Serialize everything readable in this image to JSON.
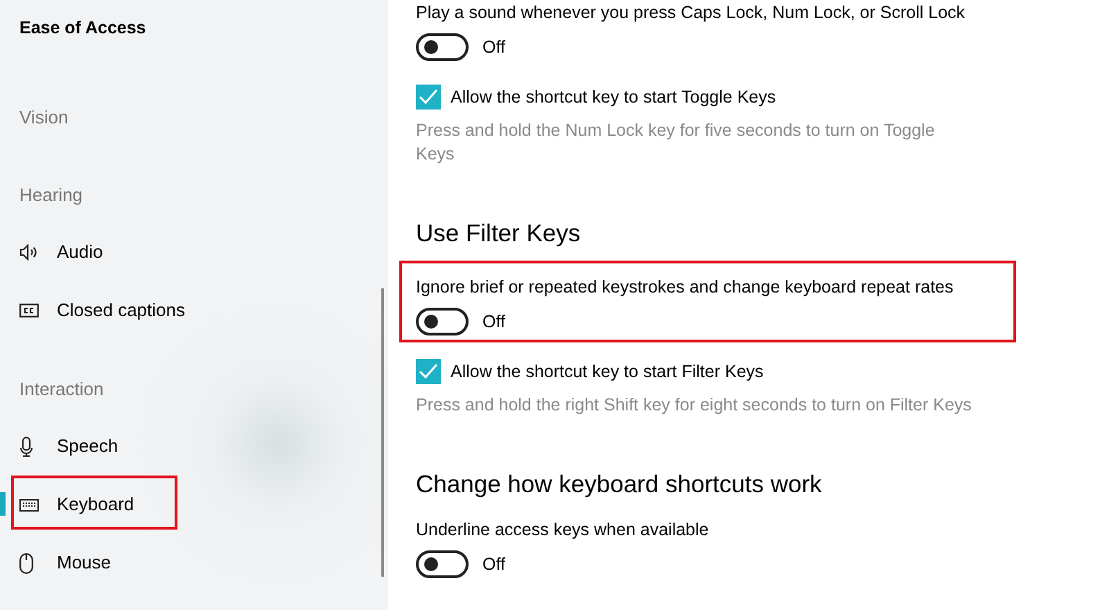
{
  "sidebar": {
    "title": "Ease of Access",
    "items": [
      {
        "kind": "group",
        "label": "Vision"
      },
      {
        "kind": "group",
        "label": "Hearing"
      },
      {
        "kind": "link",
        "label": "Audio",
        "selected": false,
        "highlighted": false
      },
      {
        "kind": "link",
        "label": "Closed captions",
        "selected": false,
        "highlighted": false
      },
      {
        "kind": "group",
        "label": "Interaction"
      },
      {
        "kind": "link",
        "label": "Speech",
        "selected": false,
        "highlighted": false
      },
      {
        "kind": "link",
        "label": "Keyboard",
        "selected": true,
        "highlighted": true
      },
      {
        "kind": "link",
        "label": "Mouse",
        "selected": false,
        "highlighted": false
      }
    ]
  },
  "settings": [
    {
      "kind": "toggle",
      "label": "Play a sound whenever you press Caps Lock, Num Lock, or Scroll Lock",
      "on": false,
      "state": "Off",
      "highlighted": false
    },
    {
      "kind": "checkbox",
      "label": "Allow the shortcut key to start Toggle Keys",
      "checked": true
    },
    {
      "kind": "description",
      "text": "Press and hold the Num Lock key for five seconds to turn on Toggle Keys"
    },
    {
      "kind": "heading",
      "text": "Use Filter Keys"
    },
    {
      "kind": "toggle",
      "label": "Ignore brief or repeated keystrokes and change keyboard repeat rates",
      "on": false,
      "state": "Off",
      "highlighted": true
    },
    {
      "kind": "checkbox",
      "label": "Allow the shortcut key to start Filter Keys",
      "checked": true
    },
    {
      "kind": "description",
      "text": "Press and hold the right Shift key for eight seconds to turn on Filter Keys"
    },
    {
      "kind": "heading",
      "text": "Change how keyboard shortcuts work"
    },
    {
      "kind": "toggle",
      "label": "Underline access keys when available",
      "on": false,
      "state": "Off",
      "highlighted": false
    }
  ]
}
